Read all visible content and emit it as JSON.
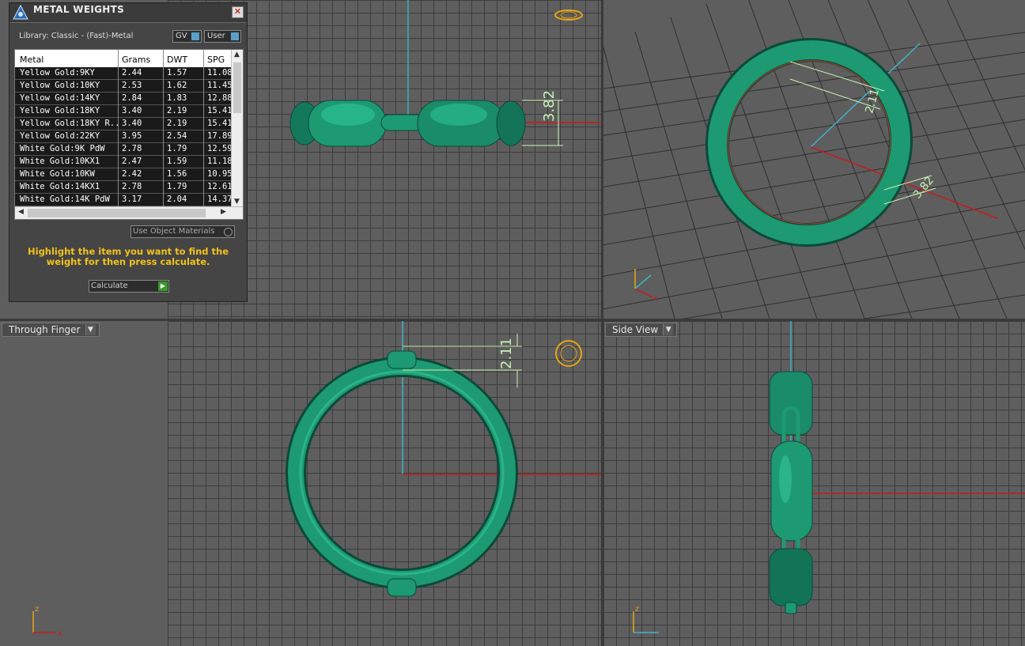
{
  "panel": {
    "title": "METAL WEIGHTS",
    "close_label": "✕",
    "library_label": "Library: Classic - (Fast)-Metal",
    "gv_label": "GV",
    "user_label": "User",
    "columns": [
      "Metal",
      "Grams",
      "DWT",
      "SPG"
    ],
    "rows": [
      [
        "Yellow Gold:9KY",
        "2.44",
        "1.57",
        "11.08"
      ],
      [
        "Yellow Gold:10KY",
        "2.53",
        "1.62",
        "11.45"
      ],
      [
        "Yellow Gold:14KY",
        "2.84",
        "1.83",
        "12.88"
      ],
      [
        "Yellow Gold:18KY",
        "3.40",
        "2.19",
        "15.41"
      ],
      [
        "Yellow Gold:18KY R...",
        "3.40",
        "2.19",
        "15.41"
      ],
      [
        "Yellow Gold:22KY",
        "3.95",
        "2.54",
        "17.89"
      ],
      [
        "White Gold:9K PdW",
        "2.78",
        "1.79",
        "12.59"
      ],
      [
        "White Gold:10KX1",
        "2.47",
        "1.59",
        "11.18"
      ],
      [
        "White Gold:10KW",
        "2.42",
        "1.56",
        "10.95"
      ],
      [
        "White Gold:14KX1",
        "2.78",
        "1.79",
        "12.61"
      ],
      [
        "White Gold:14K PdW",
        "3.17",
        "2.04",
        "14.37"
      ]
    ],
    "use_object_materials": "Use Object Materials",
    "hint": "Highlight the item you want to find the weight for then press calculate.",
    "calculate_label": "Calculate"
  },
  "viewports": {
    "top_left": {
      "dim": "3.82"
    },
    "top_right": {
      "dim_a": "2.11",
      "dim_b": "3.82",
      "axis_x": "x"
    },
    "bottom_left": {
      "label": "Through Finger",
      "dim": "2.11",
      "axis_z": "z",
      "axis_x": "x"
    },
    "bottom_right": {
      "label": "Side View",
      "axis_z": "z"
    }
  },
  "colors": {
    "ring": "#1c8f6a",
    "dim": "#c9f2b4",
    "axis_red": "#c81a1a",
    "axis_cyan": "#3fb3c6",
    "accent": "#f2c21b"
  }
}
